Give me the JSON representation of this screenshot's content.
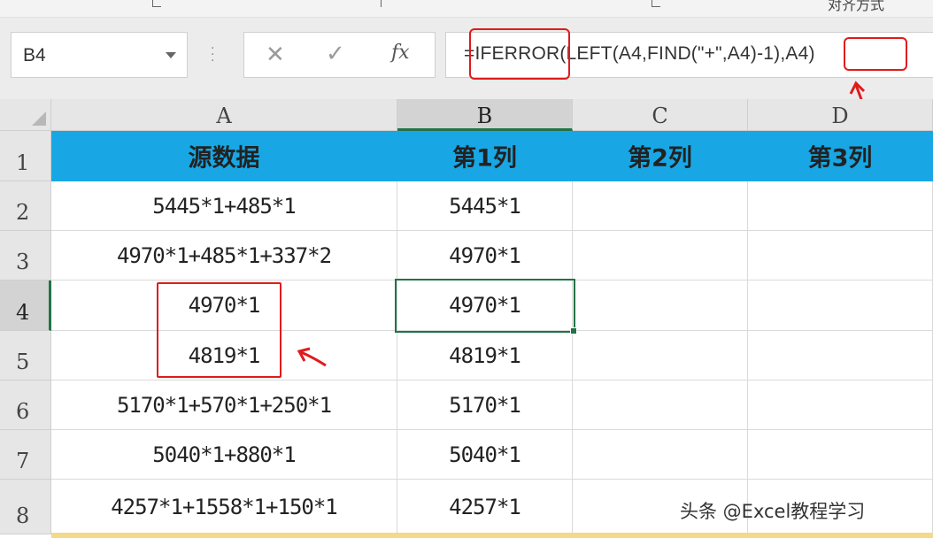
{
  "ribbon": {
    "labels": [
      "对齐方式"
    ]
  },
  "formula_bar": {
    "name_box": "B4",
    "cancel_icon": "cancel-x-icon",
    "enter_icon": "enter-check-icon",
    "fx_label": "fx",
    "formula": "=IFERROR(LEFT(A4,FIND(\"+\",A4)-1),A4)"
  },
  "sheet": {
    "columns": [
      "A",
      "B",
      "C",
      "D"
    ],
    "active_column": "B",
    "active_row": "4",
    "rows": [
      {
        "num": "1",
        "cells": [
          "源数据",
          "第1列",
          "第2列",
          "第3列"
        ]
      },
      {
        "num": "2",
        "cells": [
          "5445*1+485*1",
          "5445*1",
          "",
          ""
        ]
      },
      {
        "num": "3",
        "cells": [
          "4970*1+485*1+337*2",
          "4970*1",
          "",
          ""
        ]
      },
      {
        "num": "4",
        "cells": [
          "4970*1",
          "4970*1",
          "",
          ""
        ]
      },
      {
        "num": "5",
        "cells": [
          "4819*1",
          "4819*1",
          "",
          ""
        ]
      },
      {
        "num": "6",
        "cells": [
          "5170*1+570*1+250*1",
          "5170*1",
          "",
          ""
        ]
      },
      {
        "num": "7",
        "cells": [
          "5040*1+880*1",
          "5040*1",
          "",
          ""
        ]
      },
      {
        "num": "8",
        "cells": [
          "4257*1+1558*1+150*1",
          "4257*1",
          "",
          ""
        ]
      }
    ],
    "header_fill": "#18a7e4",
    "selection_color": "#217346",
    "annotation_color": "#e01b1b"
  },
  "watermark": "头条 @Excel教程学习"
}
